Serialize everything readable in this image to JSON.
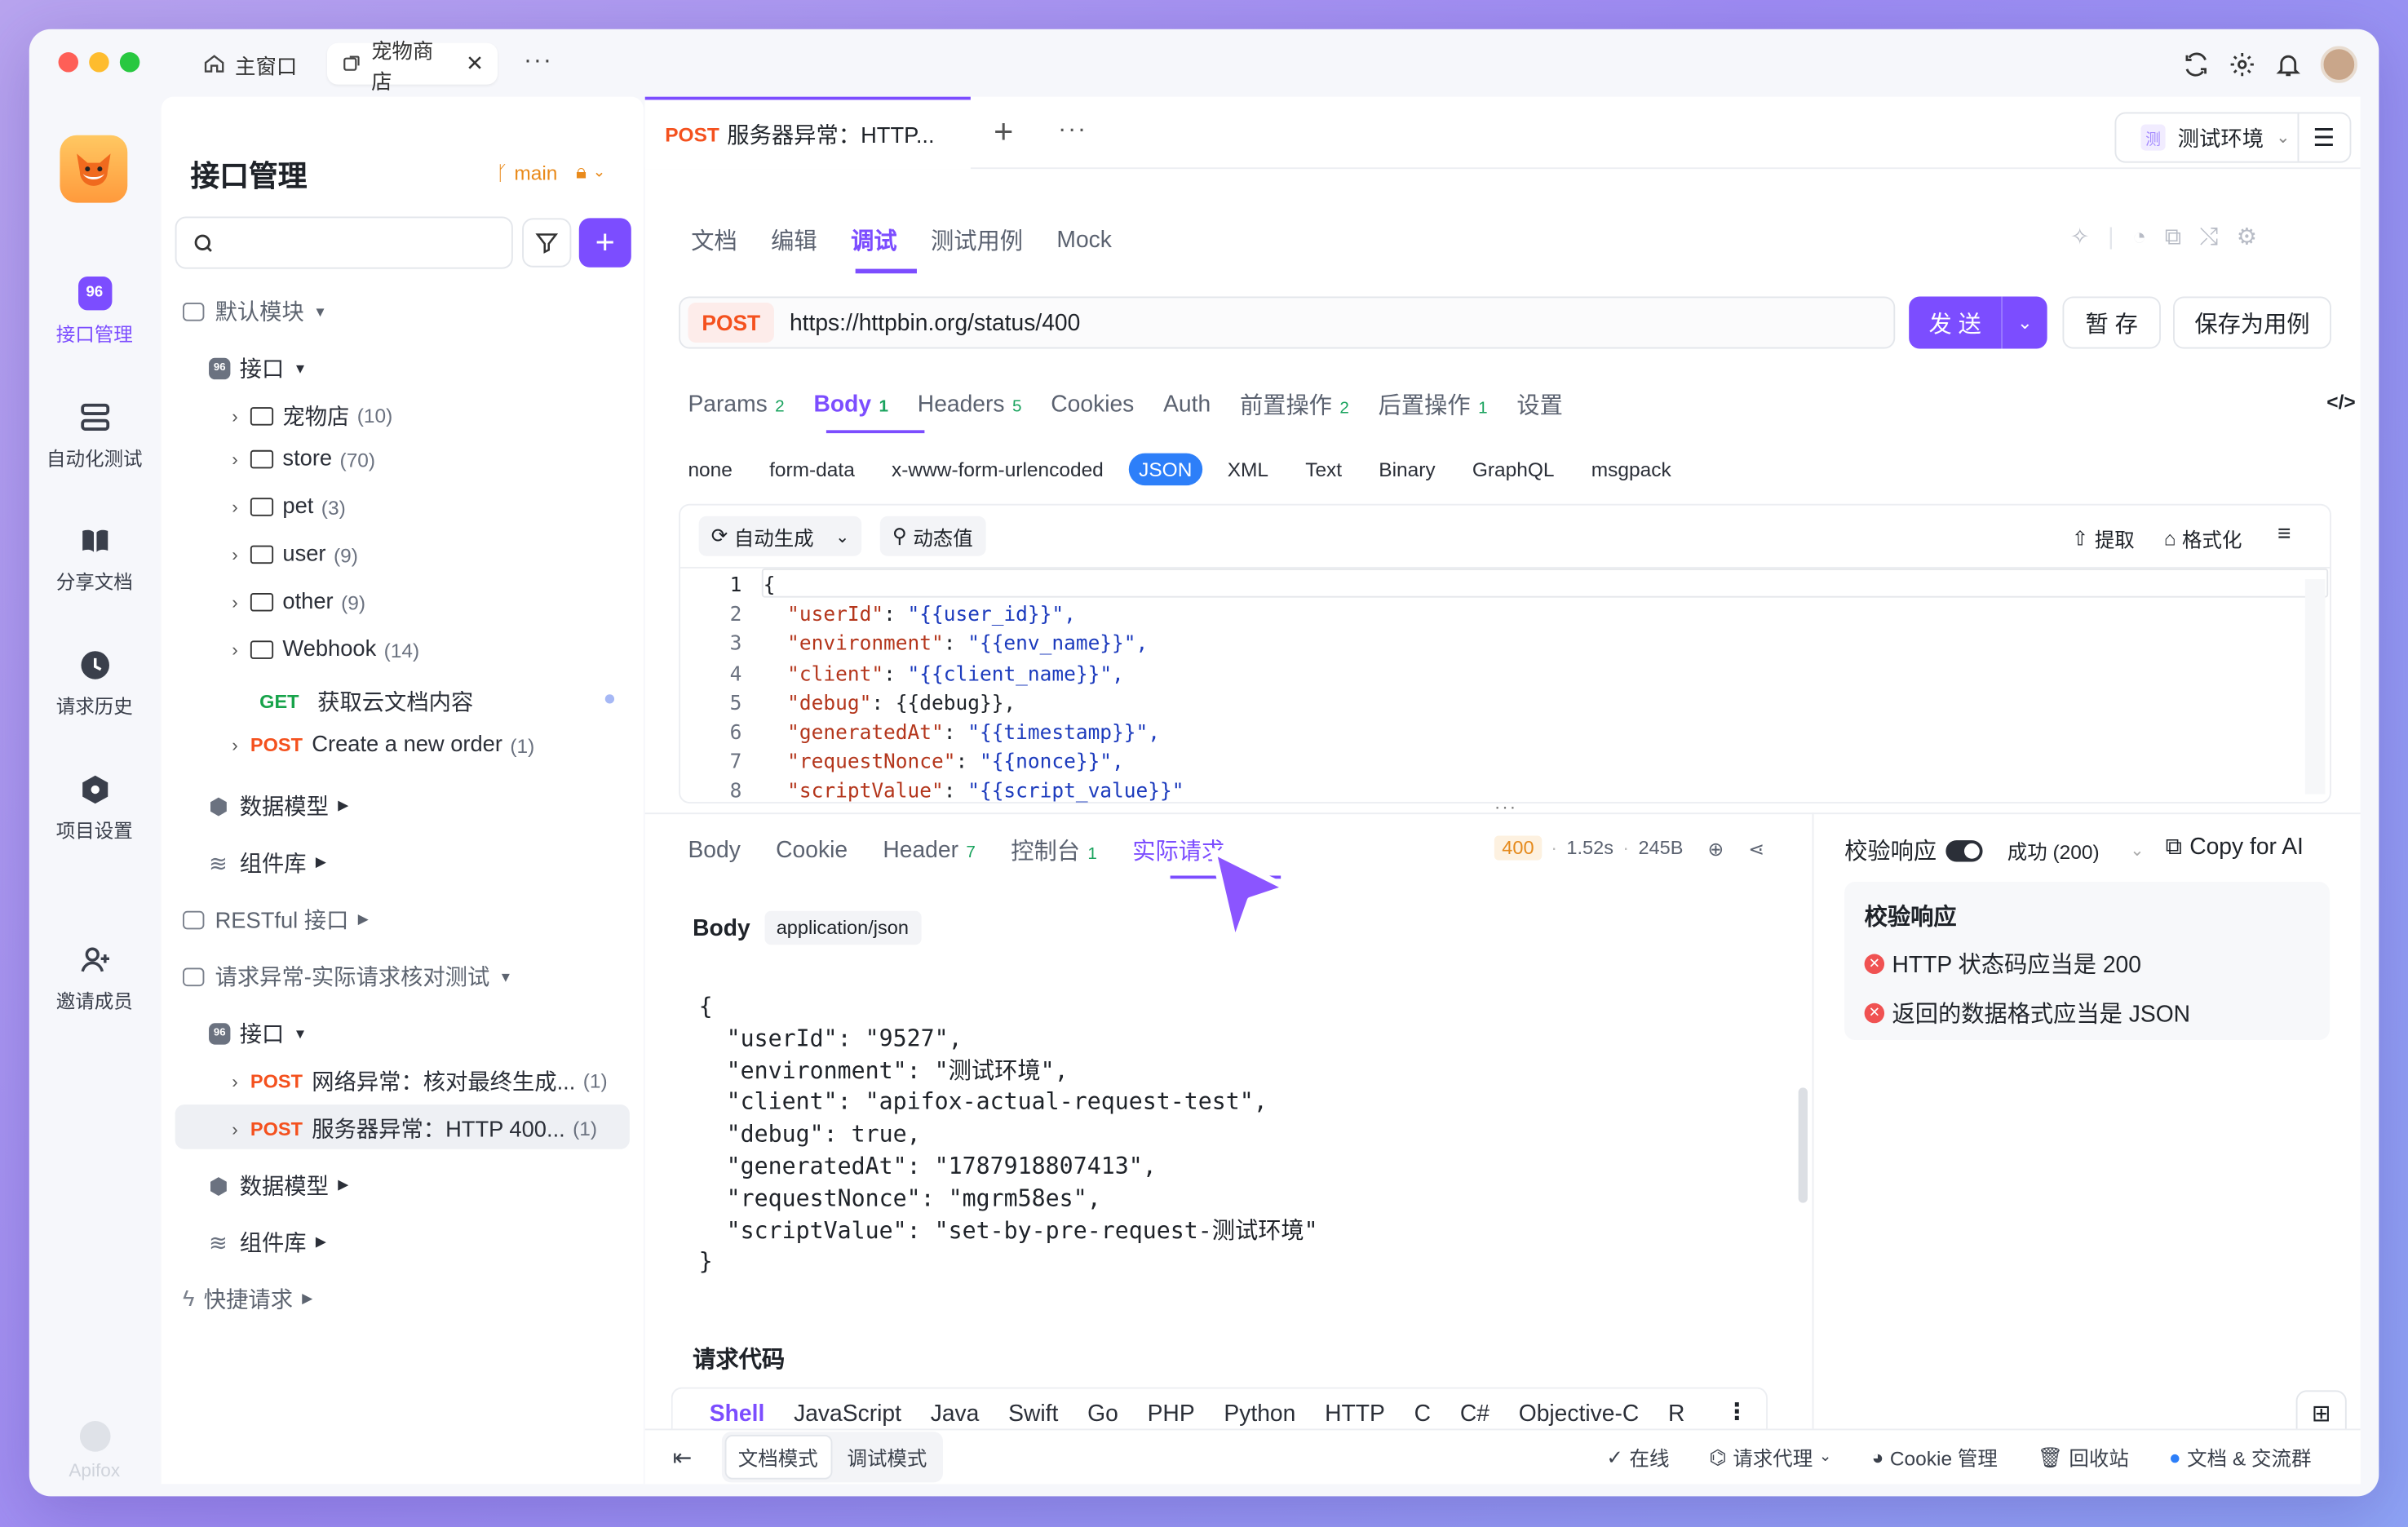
{
  "titlebar": {
    "tabs": [
      {
        "label": "主窗口"
      },
      {
        "label": "宠物商店"
      }
    ]
  },
  "rail": {
    "items": [
      {
        "label": "接口管理"
      },
      {
        "label": "自动化测试"
      },
      {
        "label": "分享文档"
      },
      {
        "label": "请求历史"
      },
      {
        "label": "项目设置"
      },
      {
        "label": "邀请成员"
      }
    ],
    "brand": "Apifox"
  },
  "sidebar": {
    "title": "接口管理",
    "branch": "main",
    "tree": [
      {
        "label": "默认模块"
      },
      {
        "label": "接口"
      },
      {
        "label": "宠物店",
        "count": "(10)"
      },
      {
        "label": "store",
        "count": "(70)"
      },
      {
        "label": "pet",
        "count": "(3)"
      },
      {
        "label": "user",
        "count": "(9)"
      },
      {
        "label": "other",
        "count": "(9)"
      },
      {
        "label": "Webhook",
        "count": "(14)"
      },
      {
        "method": "GET",
        "label": "获取云文档内容"
      },
      {
        "method": "POST",
        "label": "Create a new order",
        "count": "(1)"
      },
      {
        "label": "数据模型"
      },
      {
        "label": "组件库"
      },
      {
        "label": "RESTful 接口"
      },
      {
        "label": "请求异常-实际请求核对测试"
      },
      {
        "label": "接口"
      },
      {
        "method": "POST",
        "label": "网络异常：核对最终生成...",
        "count": "(1)"
      },
      {
        "method": "POST",
        "label": "服务器异常：HTTP 400...",
        "count": "(1)"
      },
      {
        "label": "数据模型"
      },
      {
        "label": "组件库"
      },
      {
        "label": "快捷请求"
      }
    ]
  },
  "doc_tab": {
    "method": "POST",
    "title": "服务器异常：HTTP..."
  },
  "env": {
    "badge": "测",
    "label": "测试环境"
  },
  "subtabs": [
    "文档",
    "编辑",
    "调试",
    "测试用例",
    "Mock"
  ],
  "request": {
    "method": "POST",
    "url": "https://httpbin.org/status/400",
    "send": "发 送",
    "save": "暂 存",
    "save_case": "保存为用例"
  },
  "req_tabs": [
    {
      "label": "Params",
      "n": "2"
    },
    {
      "label": "Body",
      "n": "1"
    },
    {
      "label": "Headers",
      "n": "5"
    },
    {
      "label": "Cookies",
      "n": ""
    },
    {
      "label": "Auth",
      "n": ""
    },
    {
      "label": "前置操作",
      "n": "2"
    },
    {
      "label": "后置操作",
      "n": "1"
    },
    {
      "label": "设置",
      "n": ""
    }
  ],
  "body_types": [
    "none",
    "form-data",
    "x-www-form-urlencoded",
    "JSON",
    "XML",
    "Text",
    "Binary",
    "GraphQL",
    "msgpack"
  ],
  "editor": {
    "auto": "自动生成",
    "dynamic": "动态值",
    "extract": "提取",
    "format": "格式化",
    "lines": [
      {
        "n": "1",
        "raw": "{"
      },
      {
        "n": "2",
        "k": "\"userId\"",
        "v": "\"{{user_id}}\","
      },
      {
        "n": "3",
        "k": "\"environment\"",
        "v": "\"{{env_name}}\","
      },
      {
        "n": "4",
        "k": "\"client\"",
        "v": "\"{{client_name}}\","
      },
      {
        "n": "5",
        "k": "\"debug\"",
        "v": "{{debug}},"
      },
      {
        "n": "6",
        "k": "\"generatedAt\"",
        "v": "\"{{timestamp}}\","
      },
      {
        "n": "7",
        "k": "\"requestNonce\"",
        "v": "\"{{nonce}}\","
      },
      {
        "n": "8",
        "k": "\"scriptValue\"",
        "v": "\"{{script_value}}\""
      }
    ]
  },
  "resp_tabs": [
    {
      "label": "Body",
      "n": ""
    },
    {
      "label": "Cookie",
      "n": ""
    },
    {
      "label": "Header",
      "n": "7"
    },
    {
      "label": "控制台",
      "n": "1"
    },
    {
      "label": "实际请求",
      "n": ""
    }
  ],
  "status": {
    "code": "400",
    "time": "1.52s",
    "size": "245B"
  },
  "actual": {
    "body_label": "Body",
    "content_type": "application/json",
    "json": [
      "{",
      "  \"userId\": \"9527\",",
      "  \"environment\": \"测试环境\",",
      "  \"client\": \"apifox-actual-request-test\",",
      "  \"debug\": true,",
      "  \"generatedAt\": \"1787918807413\",",
      "  \"requestNonce\": \"mgrm58es\",",
      "  \"scriptValue\": \"set-by-pre-request-测试环境\"",
      "}"
    ],
    "code_title": "请求代码",
    "langs": [
      "Shell",
      "JavaScript",
      "Java",
      "Swift",
      "Go",
      "PHP",
      "Python",
      "HTTP",
      "C",
      "C#",
      "Objective-C",
      "R"
    ]
  },
  "validate": {
    "label": "校验响应",
    "status": "成功 (200)",
    "copy_ai": "Copy for AI",
    "title": "校验响应",
    "items": [
      "HTTP 状态码应当是 200",
      "返回的数据格式应当是 JSON"
    ]
  },
  "bottom": {
    "doc_mode": "文档模式",
    "debug_mode": "调试模式",
    "online": "在线",
    "proxy": "请求代理",
    "cookie": "Cookie 管理",
    "trash": "回收站",
    "docs": "文档 & 交流群"
  }
}
